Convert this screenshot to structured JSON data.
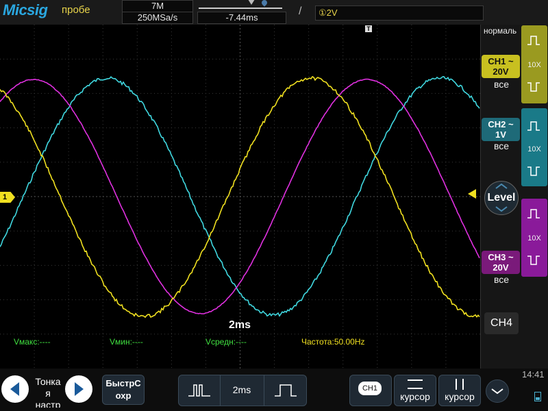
{
  "app": {
    "logo": "Micsig",
    "mode_label": "пробе"
  },
  "header": {
    "memory_depth": "7M",
    "sample_rate": "250MSa/s",
    "time_offset": "-7.44ms",
    "trigger_edge": "/",
    "trigger_info": "①2V"
  },
  "screen": {
    "timebase": "2ms",
    "ch1_marker": "1",
    "trigger_marker": "T",
    "measurements": {
      "vmax": "Vмакс:----",
      "vmin": "Vмин:----",
      "vavg": "Vсредн:----",
      "freq": "Частота:50.00Hz"
    },
    "colors": {
      "ch1": "#f0e020",
      "ch2": "#40d8e0",
      "ch3": "#e030e0",
      "grid": "#3a3a3a"
    }
  },
  "right_panel": {
    "trigger_mode": "нормаль",
    "channels": [
      {
        "name": "CH1",
        "coupling": "~",
        "scale": "20V",
        "bw": "все",
        "probe": "10X",
        "color": "#c8c020"
      },
      {
        "name": "CH2",
        "coupling": "~",
        "scale": "1V",
        "bw": "все",
        "probe": "10X",
        "color": "#30b8c8"
      },
      {
        "name": "CH3",
        "coupling": "~",
        "scale": "20V",
        "bw": "все",
        "probe": "10X",
        "color": "#c030c0"
      }
    ],
    "level_label": "Level",
    "ch4_label": "CH4"
  },
  "bottom": {
    "fine_label_1": "Тонка",
    "fine_label_2": "я",
    "fine_label_3": "настр",
    "quick_save_1": "БыстрС",
    "quick_save_2": "охр",
    "timebase_value": "2ms",
    "ch_badge": "CH1",
    "cursor_h_label": "курсор",
    "cursor_v_label": "курсор",
    "clock": "14:41"
  }
}
